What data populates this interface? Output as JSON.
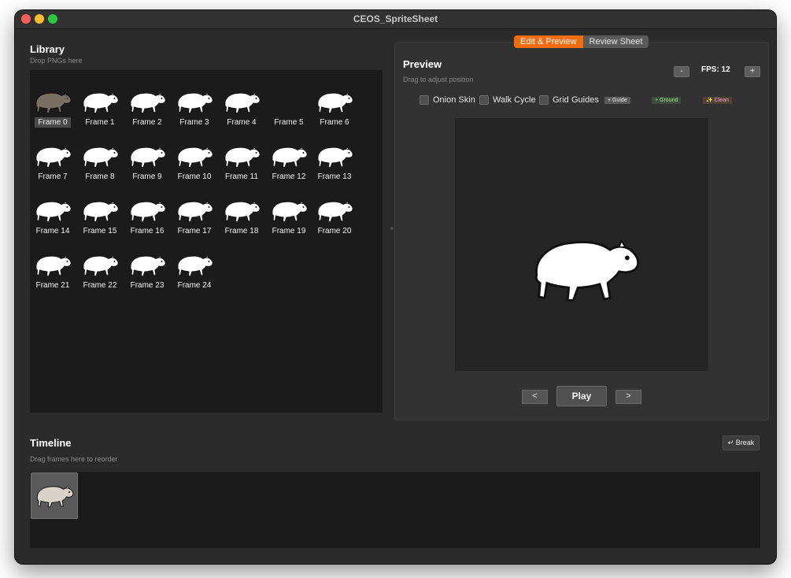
{
  "window": {
    "title": "CEOS_SpriteSheet"
  },
  "library": {
    "title": "Library",
    "hint": "Drop PNGs here",
    "frames": [
      "Frame 0",
      "Frame 1",
      "Frame 2",
      "Frame 3",
      "Frame 4",
      "Frame 5",
      "Frame 6",
      "Frame 7",
      "Frame 8",
      "Frame 9",
      "Frame 10",
      "Frame 11",
      "Frame 12",
      "Frame 13",
      "Frame 14",
      "Frame 15",
      "Frame 16",
      "Frame 17",
      "Frame 18",
      "Frame 19",
      "Frame 20",
      "Frame 21",
      "Frame 22",
      "Frame 23",
      "Frame 24"
    ],
    "selected_frame": "Frame 0",
    "empty_thumbnail_frame": "Frame 5"
  },
  "tabs": {
    "edit_preview": "Edit & Preview",
    "review_sheet": "Review Sheet",
    "active": "Edit & Preview"
  },
  "preview": {
    "title": "Preview",
    "hint": "Drag to adjust position",
    "fps_label": "FPS: 12",
    "fps_decrease": "-",
    "fps_increase": "+",
    "options": {
      "onion_skin": "Onion Skin",
      "walk_cycle": "Walk Cycle",
      "grid": "Grid",
      "guides": "Guides"
    },
    "add_guide": "+ Guide",
    "add_ground": "+ Ground",
    "clean": "✨ Clean",
    "prev": "<",
    "play": "Play",
    "next": ">"
  },
  "timeline": {
    "title": "Timeline",
    "hint": "Drag frames here to reorder",
    "break_label": "↵ Break"
  },
  "colors": {
    "accent": "#f26b0f",
    "panel": "#323232",
    "track": "#1b1b1b",
    "ground_text": "#a6e38c",
    "clean_text": "#ff9fcf"
  }
}
